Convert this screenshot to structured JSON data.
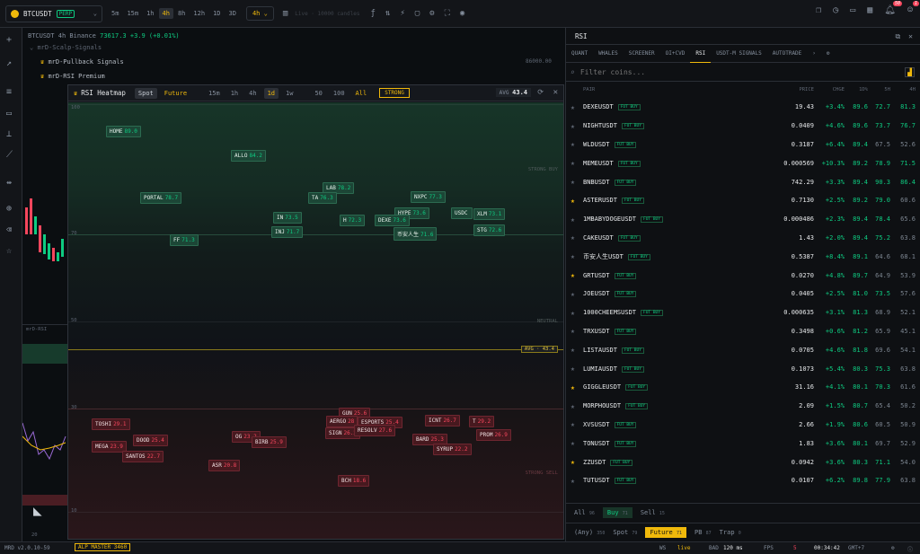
{
  "topbar": {
    "symbol": "BTCUSDT",
    "perp": "PERP",
    "timeframes": [
      "5m",
      "15m",
      "1h",
      "4h",
      "8h",
      "12h",
      "1D",
      "3D"
    ],
    "active_tf": "4h",
    "tf_select": "4h",
    "live": "Live · 10000 candles",
    "notif_count": "50",
    "alert_count": "1"
  },
  "chart": {
    "symbol": "BTCUSDT",
    "tf": "4h",
    "exchange": "Binance",
    "price": "73617.3",
    "change": "+3.9 (+0.01%)",
    "ind1": "mrD-Scalp-Signals",
    "ind2": "mrD-Pullback Signals",
    "ind3": "mrD-RSI Premium",
    "scale_label": "86000.00",
    "sub_label": "mrD-RSI",
    "sub_scale": "20"
  },
  "heatmap": {
    "title": "RSI Heatmap",
    "markets": [
      "Spot",
      "Future"
    ],
    "tfs": [
      "15m",
      "1h",
      "4h",
      "1d",
      "1w"
    ],
    "active_tf": "1d",
    "counts": [
      "50",
      "100",
      "All"
    ],
    "strong": "STRONG",
    "avg_label": "AVG",
    "avg_value": "43.4",
    "levels": [
      "100",
      "70",
      "50",
      "30",
      "10"
    ],
    "zone_buy": "STRONG BUY",
    "zone_neutral": "NEUTRAL",
    "zone_sell": "STRONG SELL",
    "avg_tag": "AVG · 43.4",
    "coins": [
      {
        "n": "HOME",
        "v": "89.0",
        "t": "g"
      },
      {
        "n": "ALLO",
        "v": "84.2",
        "t": "g"
      },
      {
        "n": "PORTAL",
        "v": "78.7",
        "t": "g"
      },
      {
        "n": "LAB",
        "v": "78.2",
        "t": "g"
      },
      {
        "n": "TA",
        "v": "76.3",
        "t": "g"
      },
      {
        "n": "NXPC",
        "v": "77.3",
        "t": "g"
      },
      {
        "n": "IN",
        "v": "73.5",
        "t": "g"
      },
      {
        "n": "HYPE",
        "v": "73.6",
        "t": "g"
      },
      {
        "n": "USDC",
        "v": "",
        "t": "g"
      },
      {
        "n": "XLM",
        "v": "73.1",
        "t": "g"
      },
      {
        "n": "H",
        "v": "72.3",
        "t": "g"
      },
      {
        "n": "DEXE",
        "v": "73.6",
        "t": "g"
      },
      {
        "n": "INJ",
        "v": "71.7",
        "t": "g"
      },
      {
        "n": "币安人生",
        "v": "71.6",
        "t": "g"
      },
      {
        "n": "STG",
        "v": "72.6",
        "t": "g"
      },
      {
        "n": "FF",
        "v": "71.3",
        "t": "g"
      },
      {
        "n": "GUN",
        "v": "25.6",
        "t": "r"
      },
      {
        "n": "TOSHI",
        "v": "29.1",
        "t": "r"
      },
      {
        "n": "AERGO",
        "v": "28",
        "t": "r"
      },
      {
        "n": "ESPORTS",
        "v": "25.4",
        "t": "r"
      },
      {
        "n": "ICNT",
        "v": "26.7",
        "t": "r"
      },
      {
        "n": "T",
        "v": "29.2",
        "t": "r"
      },
      {
        "n": "SIGN",
        "v": "26.2",
        "t": "r"
      },
      {
        "n": "RESOLV",
        "v": "27.6",
        "t": "r"
      },
      {
        "n": "PROM",
        "v": "26.9",
        "t": "r"
      },
      {
        "n": "OG",
        "v": "23.2",
        "t": "r"
      },
      {
        "n": "DOOD",
        "v": "25.4",
        "t": "r"
      },
      {
        "n": "BIRB",
        "v": "25.9",
        "t": "r"
      },
      {
        "n": "BARD",
        "v": "25.3",
        "t": "r"
      },
      {
        "n": "MEGA",
        "v": "23.9",
        "t": "r"
      },
      {
        "n": "SYRUP",
        "v": "22.2",
        "t": "r"
      },
      {
        "n": "SANTOS",
        "v": "22.7",
        "t": "r"
      },
      {
        "n": "ASR",
        "v": "20.8",
        "t": "r"
      },
      {
        "n": "BCH",
        "v": "18.6",
        "t": "r"
      }
    ]
  },
  "panel": {
    "title": "RSI",
    "tabs": [
      "QUANT",
      "WHALES",
      "SCREENER",
      "OI+CVD",
      "RSI",
      "USDT-M SIGNALS",
      "AUTOTRADE"
    ],
    "active_tab": "RSI",
    "filter_placeholder": "Filter coins...",
    "cols": [
      "PAIR",
      "PRICE",
      "CHGE",
      "1D%",
      "5H",
      "4H"
    ],
    "rows": [
      {
        "s": "DEXEUSDT",
        "fav": false,
        "tag": "FUT BUY",
        "p": "19.43",
        "c": "+3.4%",
        "a": "89.6",
        "b": "72.7",
        "d": "81.3"
      },
      {
        "s": "NIGHTUSDT",
        "fav": false,
        "tag": "FUT BUY",
        "p": "0.0409",
        "c": "+4.6%",
        "a": "89.6",
        "b": "73.7",
        "d": "76.7"
      },
      {
        "s": "WLDUSDT",
        "fav": false,
        "tag": "FUT BUY",
        "p": "0.3187",
        "c": "+6.4%",
        "a": "89.4",
        "b": "67.5",
        "d": "52.6"
      },
      {
        "s": "MEMEUSDT",
        "fav": false,
        "tag": "FUT BUY",
        "p": "0.000569",
        "c": "+10.3%",
        "a": "89.2",
        "b": "78.9",
        "d": "71.5"
      },
      {
        "s": "BNBUSDT",
        "fav": false,
        "tag": "FUT BUY",
        "p": "742.29",
        "c": "+3.3%",
        "a": "89.4",
        "b": "90.3",
        "d": "86.4"
      },
      {
        "s": "ASTERUSDT",
        "fav": true,
        "tag": "FUT BUY",
        "p": "0.7130",
        "c": "+2.5%",
        "a": "89.2",
        "b": "79.0",
        "d": "60.6"
      },
      {
        "s": "1MBABYDOGEUSDT",
        "fav": false,
        "tag": "FUT BUY",
        "p": "0.000486",
        "c": "+2.3%",
        "a": "89.4",
        "b": "78.4",
        "d": "65.6"
      },
      {
        "s": "CAKEUSDT",
        "fav": false,
        "tag": "FUT BUY",
        "p": "1.43",
        "c": "+2.0%",
        "a": "89.4",
        "b": "75.2",
        "d": "63.8"
      },
      {
        "s": "币安人生USDT",
        "fav": false,
        "tag": "FUT BUY",
        "p": "0.5387",
        "c": "+8.4%",
        "a": "89.1",
        "b": "64.6",
        "d": "68.1"
      },
      {
        "s": "GRTUSDT",
        "fav": true,
        "tag": "FUT BUY",
        "p": "0.0270",
        "c": "+4.8%",
        "a": "89.7",
        "b": "64.9",
        "d": "53.9"
      },
      {
        "s": "JOEUSDT",
        "fav": false,
        "tag": "FUT BUY",
        "p": "0.0405",
        "c": "+2.5%",
        "a": "81.0",
        "b": "73.5",
        "d": "57.6"
      },
      {
        "s": "1000CHEEMSUSDT",
        "fav": false,
        "tag": "FUT BUY",
        "p": "0.000635",
        "c": "+3.1%",
        "a": "81.3",
        "b": "68.9",
        "d": "52.1"
      },
      {
        "s": "TRXUSDT",
        "fav": false,
        "tag": "FUT BUY",
        "p": "0.3498",
        "c": "+0.6%",
        "a": "81.2",
        "b": "65.9",
        "d": "45.1"
      },
      {
        "s": "LISTAUSDT",
        "fav": false,
        "tag": "FUT BUY",
        "p": "0.0705",
        "c": "+4.6%",
        "a": "81.8",
        "b": "69.6",
        "d": "54.1"
      },
      {
        "s": "LUMIAUSDT",
        "fav": false,
        "tag": "FUT BUY",
        "p": "0.1073",
        "c": "+5.4%",
        "a": "80.3",
        "b": "75.3",
        "d": "63.8"
      },
      {
        "s": "GIGGLEUSDT",
        "fav": true,
        "tag": "FUT BUY",
        "p": "31.16",
        "c": "+4.1%",
        "a": "80.1",
        "b": "70.3",
        "d": "61.6"
      },
      {
        "s": "MORPHOUSDT",
        "fav": false,
        "tag": "FUT BUY",
        "p": "2.09",
        "c": "+1.5%",
        "a": "80.7",
        "b": "65.4",
        "d": "50.2"
      },
      {
        "s": "XVSUSDT",
        "fav": false,
        "tag": "FUT BUY",
        "p": "2.66",
        "c": "+1.9%",
        "a": "80.6",
        "b": "60.5",
        "d": "50.9"
      },
      {
        "s": "TONUSDT",
        "fav": false,
        "tag": "FUT BUY",
        "p": "1.83",
        "c": "+3.6%",
        "a": "80.1",
        "b": "69.7",
        "d": "52.9"
      },
      {
        "s": "ZZUSDT",
        "fav": true,
        "tag": "FUT BUY",
        "p": "0.0942",
        "c": "+3.6%",
        "a": "80.3",
        "b": "71.1",
        "d": "54.0"
      },
      {
        "s": "TUTUSDT",
        "fav": false,
        "tag": "FUT BUY",
        "p": "0.0107",
        "c": "+6.2%",
        "a": "89.8",
        "b": "77.9",
        "d": "63.8"
      }
    ],
    "filter_row": [
      {
        "l": "All",
        "c": "96"
      },
      {
        "l": "Buy",
        "c": "71"
      },
      {
        "l": "Sell",
        "c": "15"
      }
    ],
    "market_row": [
      {
        "l": "(Any)",
        "c": "350"
      },
      {
        "l": "Spot",
        "c": "79"
      },
      {
        "l": "Future",
        "c": "71"
      },
      {
        "l": "PB",
        "c": "87"
      },
      {
        "l": "Trap",
        "c": "0"
      }
    ]
  },
  "status": {
    "version": "MRD v2.0.10-59",
    "alp": "ALP MASTER 3460",
    "ws": "WS",
    "live": "live",
    "bad": "BAD",
    "latency": "120 ms",
    "fps": "FPS",
    "fps_v": "5",
    "time": "00:34:42",
    "tz": "GMT+7"
  },
  "colors": {
    "accent": "#f0b90b",
    "up": "#0ecb81",
    "down": "#f6465d"
  }
}
